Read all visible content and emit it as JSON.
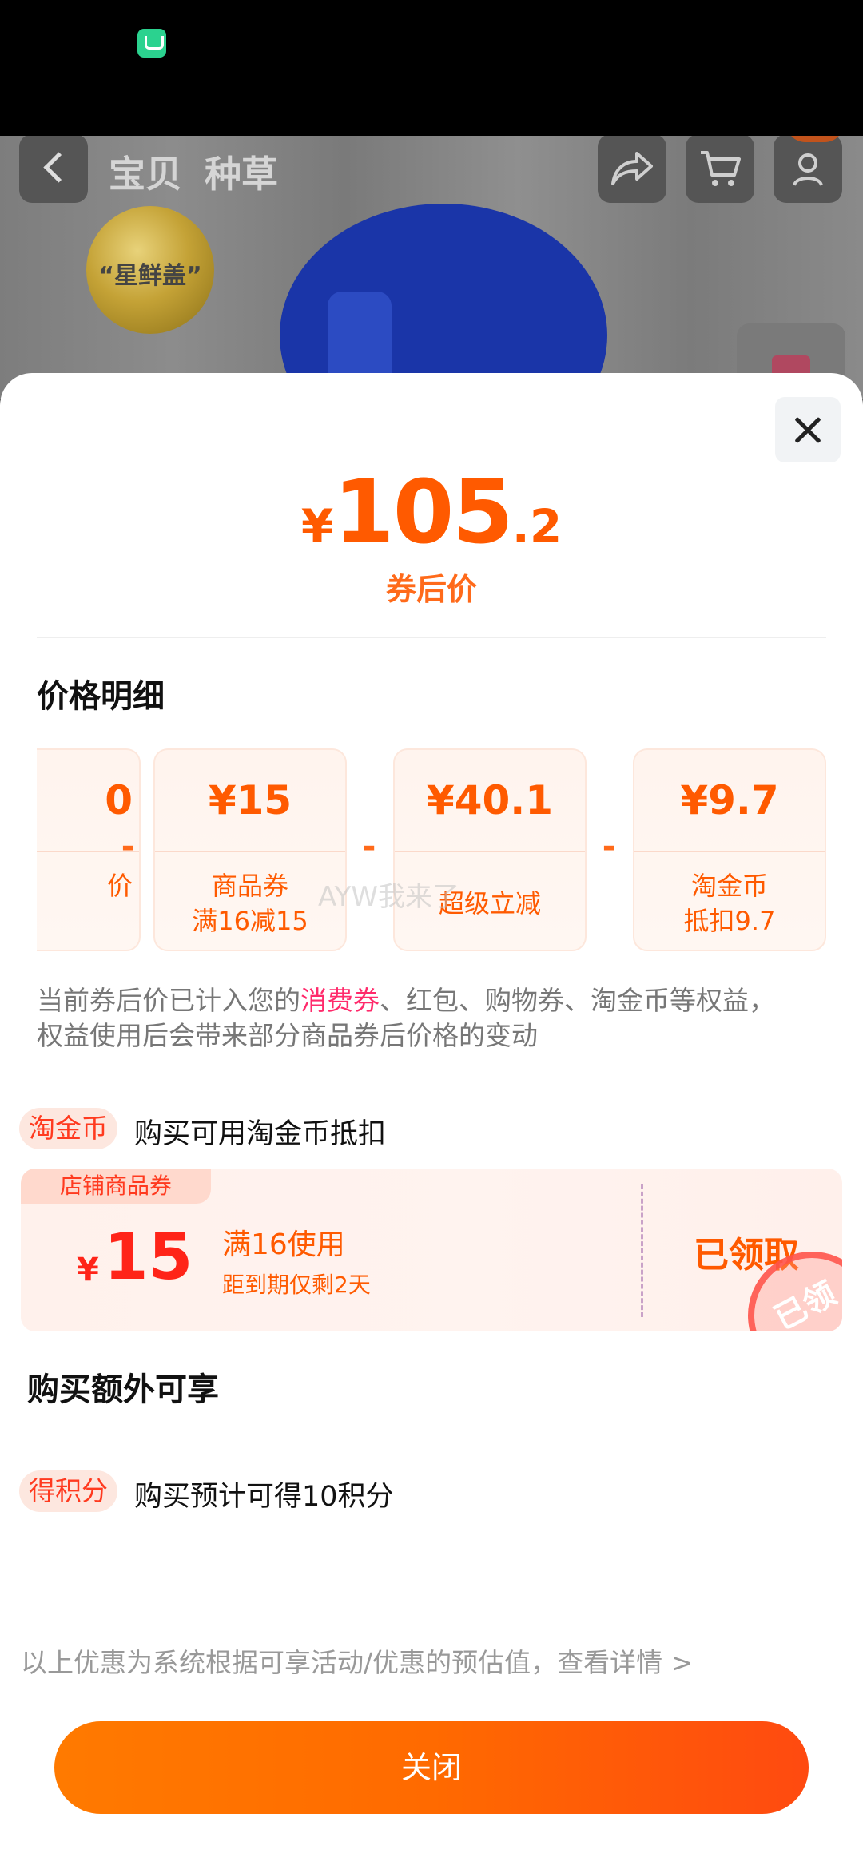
{
  "background": {
    "tabs": [
      "宝贝",
      "种草"
    ],
    "badge_text": "“星鲜盖”"
  },
  "price": {
    "symbol": "¥",
    "integer": "105",
    "decimal": ".2",
    "label": "券后价"
  },
  "details": {
    "title": "价格明细",
    "cards": [
      {
        "amount": "0",
        "desc": [
          "",
          "价"
        ]
      },
      {
        "amount": "¥15",
        "desc": [
          "商品券",
          "满16减15"
        ]
      },
      {
        "amount": "¥40.1",
        "desc": [
          "超级立减",
          ""
        ]
      },
      {
        "amount": "¥9.7",
        "desc": [
          "淘金币",
          "抵扣9.7"
        ]
      }
    ],
    "operator": "-",
    "watermark": "AYW我来了"
  },
  "note": {
    "line1_pre": "当前券后价已计入您的",
    "line1_highlight": "消费券",
    "line1_post": "、红包、购物券、淘金币等权益，",
    "line2": "权益使用后会带来部分商品券后价格的变动"
  },
  "coin_row": {
    "tag": "淘金币",
    "text": "购买可用淘金币抵扣"
  },
  "coupon": {
    "badge": "店铺商品券",
    "symbol": "¥",
    "amount": "15",
    "condition": "满16使用",
    "expiry": "距到期仅剩2天",
    "status": "已领取",
    "stamp": "已领"
  },
  "extra": {
    "title": "购买额外可享",
    "tag": "得积分",
    "text": "购买预计可得10积分"
  },
  "footnote": "以上优惠为系统根据可享活动/优惠的预估值，查看详情 >",
  "close_button": "关闭",
  "colors": {
    "accent": "#ff5a00",
    "coupon_red": "#ff2418",
    "highlight": "#ff2a6b"
  }
}
